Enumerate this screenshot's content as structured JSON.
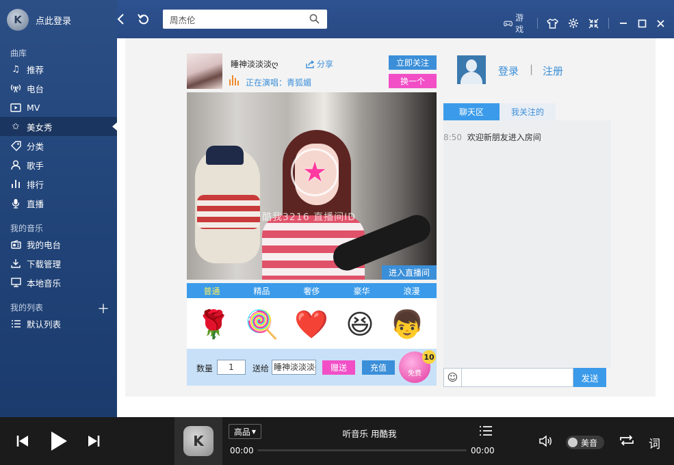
{
  "app": {
    "login_label": "点此登录",
    "logo_letter": "K"
  },
  "search": {
    "value": "周杰伦",
    "placeholder": ""
  },
  "toolbar": {
    "game_label": "游戏"
  },
  "sidebar": {
    "library_title": "曲库",
    "library": [
      {
        "label": "推荐",
        "icon": "music-note-icon"
      },
      {
        "label": "电台",
        "icon": "radio-icon"
      },
      {
        "label": "MV",
        "icon": "mv-icon"
      },
      {
        "label": "美女秀",
        "icon": "star-icon",
        "active": true
      },
      {
        "label": "分类",
        "icon": "tag-icon"
      },
      {
        "label": "歌手",
        "icon": "person-icon"
      },
      {
        "label": "排行",
        "icon": "chart-icon"
      },
      {
        "label": "直播",
        "icon": "mic-icon"
      }
    ],
    "mymusic_title": "我的音乐",
    "mymusic": [
      {
        "label": "我的电台",
        "icon": "radio-icon"
      },
      {
        "label": "下载管理",
        "icon": "download-icon"
      },
      {
        "label": "本地音乐",
        "icon": "monitor-icon"
      }
    ],
    "playlist_title": "我的列表",
    "playlists": [
      {
        "label": "默认列表",
        "icon": "list-icon"
      }
    ]
  },
  "live": {
    "host_name": "睡神淡淡淡ღ",
    "share_label": "分享",
    "singing_label": "正在演唱：青狐媚",
    "follow_label": "立即关注",
    "switch_label": "换一个",
    "watermark": "酷我3216 直播间ID",
    "enter_room_label": "进入直播间",
    "gift_tabs": [
      "普通",
      "精品",
      "奢侈",
      "豪华",
      "浪漫"
    ],
    "gifts": [
      "🌹",
      "🍭",
      "❤️",
      "😆",
      "👦"
    ],
    "qty_label": "数量",
    "qty_value": "1",
    "to_label": "送给",
    "to_value": "睡神淡淡淡ღ",
    "gift_btn_label": "赠送",
    "recharge_label": "充值",
    "free_label": "免费",
    "free_count": "10"
  },
  "account": {
    "login_label": "登录",
    "sep": "|",
    "register_label": "注册"
  },
  "chat": {
    "tabs": [
      "聊天区",
      "我关注的"
    ],
    "messages": [
      {
        "time": "8:50",
        "text": "欢迎新朋友进入房间"
      }
    ],
    "send_label": "发送"
  },
  "player": {
    "quality_label": "高品",
    "song_title": "听音乐 用酷我",
    "time_current": "00:00",
    "time_total": "00:00",
    "progress": 0,
    "fx_label": "美音",
    "lyric_label": "词"
  },
  "colors": {
    "accent": "#3b9bea",
    "pink": "#f24fc7",
    "sidebar": "#22457a"
  }
}
